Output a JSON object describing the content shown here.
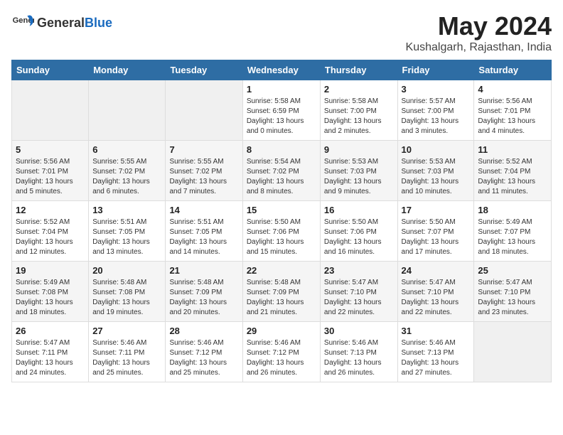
{
  "header": {
    "logo_general": "General",
    "logo_blue": "Blue",
    "month": "May 2024",
    "location": "Kushalgarh, Rajasthan, India"
  },
  "days_of_week": [
    "Sunday",
    "Monday",
    "Tuesday",
    "Wednesday",
    "Thursday",
    "Friday",
    "Saturday"
  ],
  "weeks": [
    [
      {
        "day": "",
        "info": ""
      },
      {
        "day": "",
        "info": ""
      },
      {
        "day": "",
        "info": ""
      },
      {
        "day": "1",
        "info": "Sunrise: 5:58 AM\nSunset: 6:59 PM\nDaylight: 13 hours and 0 minutes."
      },
      {
        "day": "2",
        "info": "Sunrise: 5:58 AM\nSunset: 7:00 PM\nDaylight: 13 hours and 2 minutes."
      },
      {
        "day": "3",
        "info": "Sunrise: 5:57 AM\nSunset: 7:00 PM\nDaylight: 13 hours and 3 minutes."
      },
      {
        "day": "4",
        "info": "Sunrise: 5:56 AM\nSunset: 7:01 PM\nDaylight: 13 hours and 4 minutes."
      }
    ],
    [
      {
        "day": "5",
        "info": "Sunrise: 5:56 AM\nSunset: 7:01 PM\nDaylight: 13 hours and 5 minutes."
      },
      {
        "day": "6",
        "info": "Sunrise: 5:55 AM\nSunset: 7:02 PM\nDaylight: 13 hours and 6 minutes."
      },
      {
        "day": "7",
        "info": "Sunrise: 5:55 AM\nSunset: 7:02 PM\nDaylight: 13 hours and 7 minutes."
      },
      {
        "day": "8",
        "info": "Sunrise: 5:54 AM\nSunset: 7:02 PM\nDaylight: 13 hours and 8 minutes."
      },
      {
        "day": "9",
        "info": "Sunrise: 5:53 AM\nSunset: 7:03 PM\nDaylight: 13 hours and 9 minutes."
      },
      {
        "day": "10",
        "info": "Sunrise: 5:53 AM\nSunset: 7:03 PM\nDaylight: 13 hours and 10 minutes."
      },
      {
        "day": "11",
        "info": "Sunrise: 5:52 AM\nSunset: 7:04 PM\nDaylight: 13 hours and 11 minutes."
      }
    ],
    [
      {
        "day": "12",
        "info": "Sunrise: 5:52 AM\nSunset: 7:04 PM\nDaylight: 13 hours and 12 minutes."
      },
      {
        "day": "13",
        "info": "Sunrise: 5:51 AM\nSunset: 7:05 PM\nDaylight: 13 hours and 13 minutes."
      },
      {
        "day": "14",
        "info": "Sunrise: 5:51 AM\nSunset: 7:05 PM\nDaylight: 13 hours and 14 minutes."
      },
      {
        "day": "15",
        "info": "Sunrise: 5:50 AM\nSunset: 7:06 PM\nDaylight: 13 hours and 15 minutes."
      },
      {
        "day": "16",
        "info": "Sunrise: 5:50 AM\nSunset: 7:06 PM\nDaylight: 13 hours and 16 minutes."
      },
      {
        "day": "17",
        "info": "Sunrise: 5:50 AM\nSunset: 7:07 PM\nDaylight: 13 hours and 17 minutes."
      },
      {
        "day": "18",
        "info": "Sunrise: 5:49 AM\nSunset: 7:07 PM\nDaylight: 13 hours and 18 minutes."
      }
    ],
    [
      {
        "day": "19",
        "info": "Sunrise: 5:49 AM\nSunset: 7:08 PM\nDaylight: 13 hours and 18 minutes."
      },
      {
        "day": "20",
        "info": "Sunrise: 5:48 AM\nSunset: 7:08 PM\nDaylight: 13 hours and 19 minutes."
      },
      {
        "day": "21",
        "info": "Sunrise: 5:48 AM\nSunset: 7:09 PM\nDaylight: 13 hours and 20 minutes."
      },
      {
        "day": "22",
        "info": "Sunrise: 5:48 AM\nSunset: 7:09 PM\nDaylight: 13 hours and 21 minutes."
      },
      {
        "day": "23",
        "info": "Sunrise: 5:47 AM\nSunset: 7:10 PM\nDaylight: 13 hours and 22 minutes."
      },
      {
        "day": "24",
        "info": "Sunrise: 5:47 AM\nSunset: 7:10 PM\nDaylight: 13 hours and 22 minutes."
      },
      {
        "day": "25",
        "info": "Sunrise: 5:47 AM\nSunset: 7:10 PM\nDaylight: 13 hours and 23 minutes."
      }
    ],
    [
      {
        "day": "26",
        "info": "Sunrise: 5:47 AM\nSunset: 7:11 PM\nDaylight: 13 hours and 24 minutes."
      },
      {
        "day": "27",
        "info": "Sunrise: 5:46 AM\nSunset: 7:11 PM\nDaylight: 13 hours and 25 minutes."
      },
      {
        "day": "28",
        "info": "Sunrise: 5:46 AM\nSunset: 7:12 PM\nDaylight: 13 hours and 25 minutes."
      },
      {
        "day": "29",
        "info": "Sunrise: 5:46 AM\nSunset: 7:12 PM\nDaylight: 13 hours and 26 minutes."
      },
      {
        "day": "30",
        "info": "Sunrise: 5:46 AM\nSunset: 7:13 PM\nDaylight: 13 hours and 26 minutes."
      },
      {
        "day": "31",
        "info": "Sunrise: 5:46 AM\nSunset: 7:13 PM\nDaylight: 13 hours and 27 minutes."
      },
      {
        "day": "",
        "info": ""
      }
    ]
  ]
}
